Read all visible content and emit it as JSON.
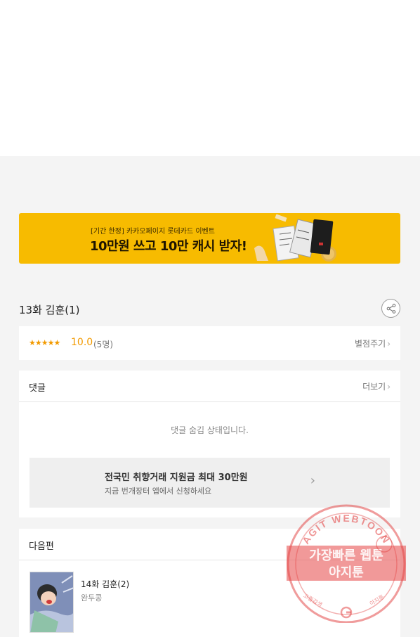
{
  "banner": {
    "subtitle": "[기간 한정] 카카오페이지 롯데카드 이벤트",
    "title": "10만원 쓰고 10만 캐시 받자!"
  },
  "episode": {
    "title": "13화 김훈(1)",
    "share_icon": "share-icon"
  },
  "rating": {
    "stars": "★★★★★",
    "score": "10.0",
    "count": "(5명)",
    "rate_label": "별점주기"
  },
  "comments": {
    "title": "댓글",
    "more_label": "더보기",
    "hidden_message": "댓글 숨김 상태입니다."
  },
  "ad": {
    "title": "전국민 취향거래 지원금 최대 30만원",
    "description": "지금 번개장터 앱에서 신청하세요"
  },
  "next": {
    "title": "다음편",
    "episode_title": "14화 김훈(2)",
    "author": "완두콩"
  },
  "watermark": {
    "arc_text": "AGIT WEBTOON",
    "line1": "가장빠른 웹툰",
    "line2": "아지툰",
    "bottom_left": "고퀄검색",
    "bottom_right": "아지툰"
  },
  "colors": {
    "banner_bg": "#f7bb00",
    "accent_orange": "#f29a00",
    "stamp_red": "#e23a3a"
  }
}
